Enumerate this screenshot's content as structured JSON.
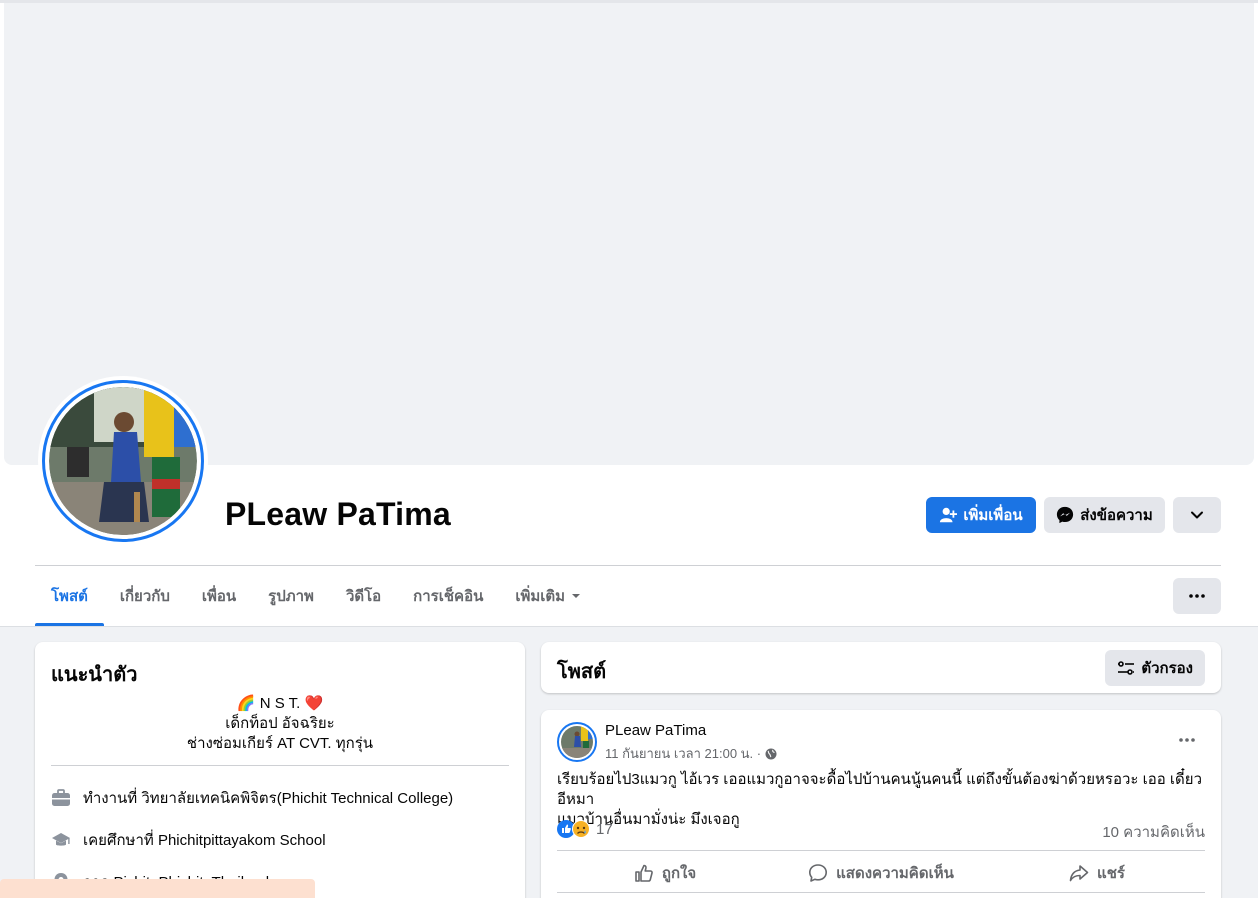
{
  "profile": {
    "name": "PLeaw PaTima"
  },
  "actions": {
    "add_friend": "เพิ่มเพื่อน",
    "message": "ส่งข้อความ"
  },
  "tabs": [
    {
      "label": "โพสต์",
      "active": true
    },
    {
      "label": "เกี่ยวกับ",
      "active": false
    },
    {
      "label": "เพื่อน",
      "active": false
    },
    {
      "label": "รูปภาพ",
      "active": false
    },
    {
      "label": "วิดีโอ",
      "active": false
    },
    {
      "label": "การเช็คอิน",
      "active": false
    },
    {
      "label": "เพิ่มเติม",
      "active": false
    }
  ],
  "intro": {
    "title": "แนะนำตัว",
    "bio": [
      "🌈 N S T. ❤️",
      "เด็กท็อป อัจฉริยะ",
      "ช่างซ่อมเกียร์ AT CVT. ทุกรุ่น"
    ],
    "work_prefix": "ทำงานที่",
    "work": "วิทยาลัยเทคนิคพิจิตร(Phichit Technical College)",
    "edu_prefix": "เคยศึกษาที่",
    "edu": "Phichitpittayakom School",
    "location": "จาก Pichit, Phichit, Thailand"
  },
  "posts_header": {
    "title": "โพสต์",
    "filter_label": "ตัวกรอง"
  },
  "post": {
    "author": "PLeaw PaTima",
    "time": "11 กันยายน เวลา 21:00 น. ·",
    "text_lines": [
      "เรียบร้อยไป3แมวกู ไอ้เวร เออแมวกูอาจจะดื้อไปบ้านคนนู้นคนนี้ แต่ถึงขั้นต้องฆ่าด้วยหรอวะ เออ เดี๋ยวอีหมา",
      "แมวบ้านอื่นมามั่งน่ะ มึงเจอกู"
    ],
    "reaction_count": "17",
    "comment_count": "10 ความคิดเห็น",
    "like_label": "ถูกใจ",
    "comment_label": "แสดงความคิดเห็น",
    "share_label": "แชร์"
  },
  "colors": {
    "accent": "#1b74e4",
    "secondary_button": "#e4e6eb",
    "page_bg": "#f0f2f5"
  }
}
